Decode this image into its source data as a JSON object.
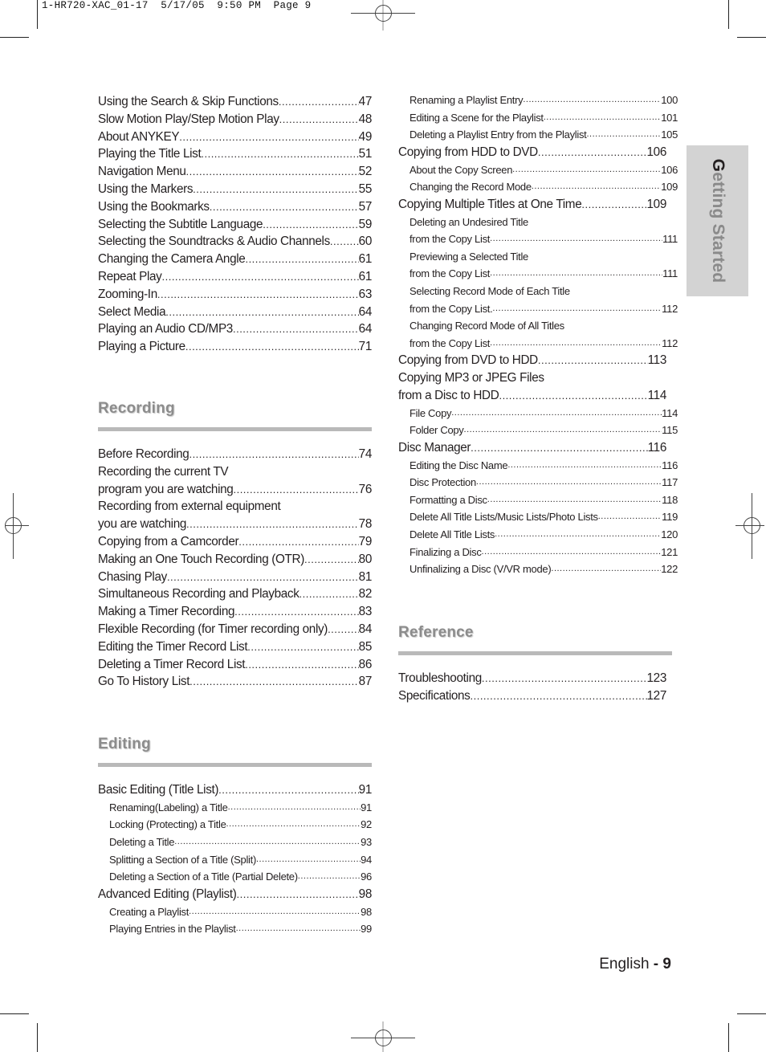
{
  "slug_line": "1-HR720-XAC_01-17  5/17/05  9:50 PM  Page 9",
  "side_tab": {
    "first_letter": "G",
    "rest": "etting Started"
  },
  "footer": {
    "language": "English",
    "separator": " - ",
    "page": "9"
  },
  "left_column": {
    "playback_entries": [
      {
        "title": "Using the Search & Skip Functions",
        "page": "47"
      },
      {
        "title": "Slow Motion Play/Step Motion Play",
        "page": "48"
      },
      {
        "title": "About ANYKEY ",
        "page": "49"
      },
      {
        "title": "Playing the Title List",
        "page": "51"
      },
      {
        "title": "Navigation Menu",
        "page": "52"
      },
      {
        "title": "Using the Markers",
        "page": "55"
      },
      {
        "title": "Using the Bookmarks ",
        "page": "57"
      },
      {
        "title": "Selecting the Subtitle Language ",
        "page": "59"
      },
      {
        "title": "Selecting the Soundtracks & Audio Channels ",
        "page": "60"
      },
      {
        "title": "Changing the Camera Angle",
        "page": "61"
      },
      {
        "title": "Repeat Play",
        "page": "61"
      },
      {
        "title": "Zooming-In ",
        "page": "63"
      },
      {
        "title": "Select Media",
        "page": "64"
      },
      {
        "title": "Playing an Audio CD/MP3",
        "page": "64"
      },
      {
        "title": "Playing a Picture ",
        "page": "71"
      }
    ],
    "recording": {
      "heading": "Recording",
      "entries": [
        {
          "title": "Before Recording",
          "page": "74"
        },
        {
          "title": "Recording the current TV",
          "page": ""
        },
        {
          "title": "program you are watching",
          "page": "76"
        },
        {
          "title": "Recording from external equipment",
          "page": ""
        },
        {
          "title": "you are watching",
          "page": "78"
        },
        {
          "title": "Copying from a Camcorder",
          "page": "79"
        },
        {
          "title": "Making an One Touch Recording (OTR) ",
          "page": "80"
        },
        {
          "title": "Chasing Play ",
          "page": "81"
        },
        {
          "title": "Simultaneous Recording and Playback ",
          "page": "82"
        },
        {
          "title": "Making a Timer Recording  ",
          "page": "83"
        },
        {
          "title": "Flexible Recording (for Timer recording only)",
          "page": "84"
        },
        {
          "title": "Editing the Timer Record List",
          "page": "85"
        },
        {
          "title": "Deleting a Timer Record List",
          "page": "86"
        },
        {
          "title": "Go To History List",
          "page": "87"
        }
      ]
    },
    "editing": {
      "heading": "Editing",
      "entries": [
        {
          "title": "Basic Editing (Title List) ",
          "page": "91",
          "level": 1
        },
        {
          "title": "Renaming(Labeling) a Title",
          "page": "91",
          "level": 2
        },
        {
          "title": "Locking (Protecting) a Title  ",
          "page": "92",
          "level": 2
        },
        {
          "title": "Deleting a Title",
          "page": "93",
          "level": 2
        },
        {
          "title": "Splitting a Section of a Title (Split) ",
          "page": "94",
          "level": 2
        },
        {
          "title": "Deleting a Section of a Title (Partial Delete) ",
          "page": "96",
          "level": 2
        },
        {
          "title": "Advanced Editing (Playlist) ",
          "page": "98",
          "level": 1
        },
        {
          "title": "Creating a Playlist  ",
          "page": "98",
          "level": 2
        },
        {
          "title": "Playing Entries in the Playlist  ",
          "page": "99",
          "level": 2
        }
      ]
    }
  },
  "right_column": {
    "entries": [
      {
        "title": "Renaming a Playlist Entry ",
        "page": "100",
        "level": 2
      },
      {
        "title": "Editing a Scene for the Playlist",
        "page": "101",
        "level": 2
      },
      {
        "title": "Deleting a Playlist Entry from the Playlist ",
        "page": "105",
        "level": 2
      },
      {
        "title": "Copying from HDD to DVD",
        "page": "106",
        "level": 1
      },
      {
        "title": "About the Copy Screen ",
        "page": "106",
        "level": 2
      },
      {
        "title": "Changing the Record Mode ",
        "page": "109",
        "level": 2
      },
      {
        "title": "Copying Multiple Titles at One Time ",
        "page": "109",
        "level": 1
      },
      {
        "title": "Deleting an Undesired Title",
        "page": "",
        "level": 2
      },
      {
        "title": "from the Copy List",
        "page": "111",
        "level": 2
      },
      {
        "title": "Previewing a Selected Title",
        "page": "",
        "level": 2
      },
      {
        "title": "from the Copy List",
        "page": "111",
        "level": 2
      },
      {
        "title": "Selecting Record Mode of Each Title",
        "page": "",
        "level": 2
      },
      {
        "title": " from the Copy List. ",
        "page": "112",
        "level": 2
      },
      {
        "title": "Changing Record Mode of All Titles",
        "page": "",
        "level": 2
      },
      {
        "title": " from the Copy List ",
        "page": "112",
        "level": 2
      },
      {
        "title": "Copying from DVD to HDD",
        "page": "113",
        "level": 1
      },
      {
        "title": "Copying MP3 or JPEG Files",
        "page": "",
        "level": 1
      },
      {
        "title": "from a Disc to HDD ",
        "page": "114",
        "level": 1
      },
      {
        "title": "File Copy",
        "page": "114",
        "level": 2
      },
      {
        "title": "Folder Copy ",
        "page": "115",
        "level": 2
      },
      {
        "title": "Disc Manager",
        "page": "116",
        "level": 1
      },
      {
        "title": "Editing the Disc Name ",
        "page": "116",
        "level": 2
      },
      {
        "title": "Disc Protection",
        "page": "117",
        "level": 2
      },
      {
        "title": "Formatting a Disc ",
        "page": "118",
        "level": 2
      },
      {
        "title": "Delete All Title Lists/Music Lists/Photo Lists ",
        "page": "119",
        "level": 2
      },
      {
        "title": "Delete All Title Lists  ",
        "page": "120",
        "level": 2
      },
      {
        "title": "Finalizing a Disc ",
        "page": " 121",
        "level": 2
      },
      {
        "title": "Unfinalizing a Disc (V/VR mode) ",
        "page": "122",
        "level": 2
      }
    ],
    "reference": {
      "heading": "Reference",
      "entries": [
        {
          "title": "Troubleshooting",
          "page": "123"
        },
        {
          "title": "Specifications ",
          "page": "127"
        }
      ]
    }
  }
}
